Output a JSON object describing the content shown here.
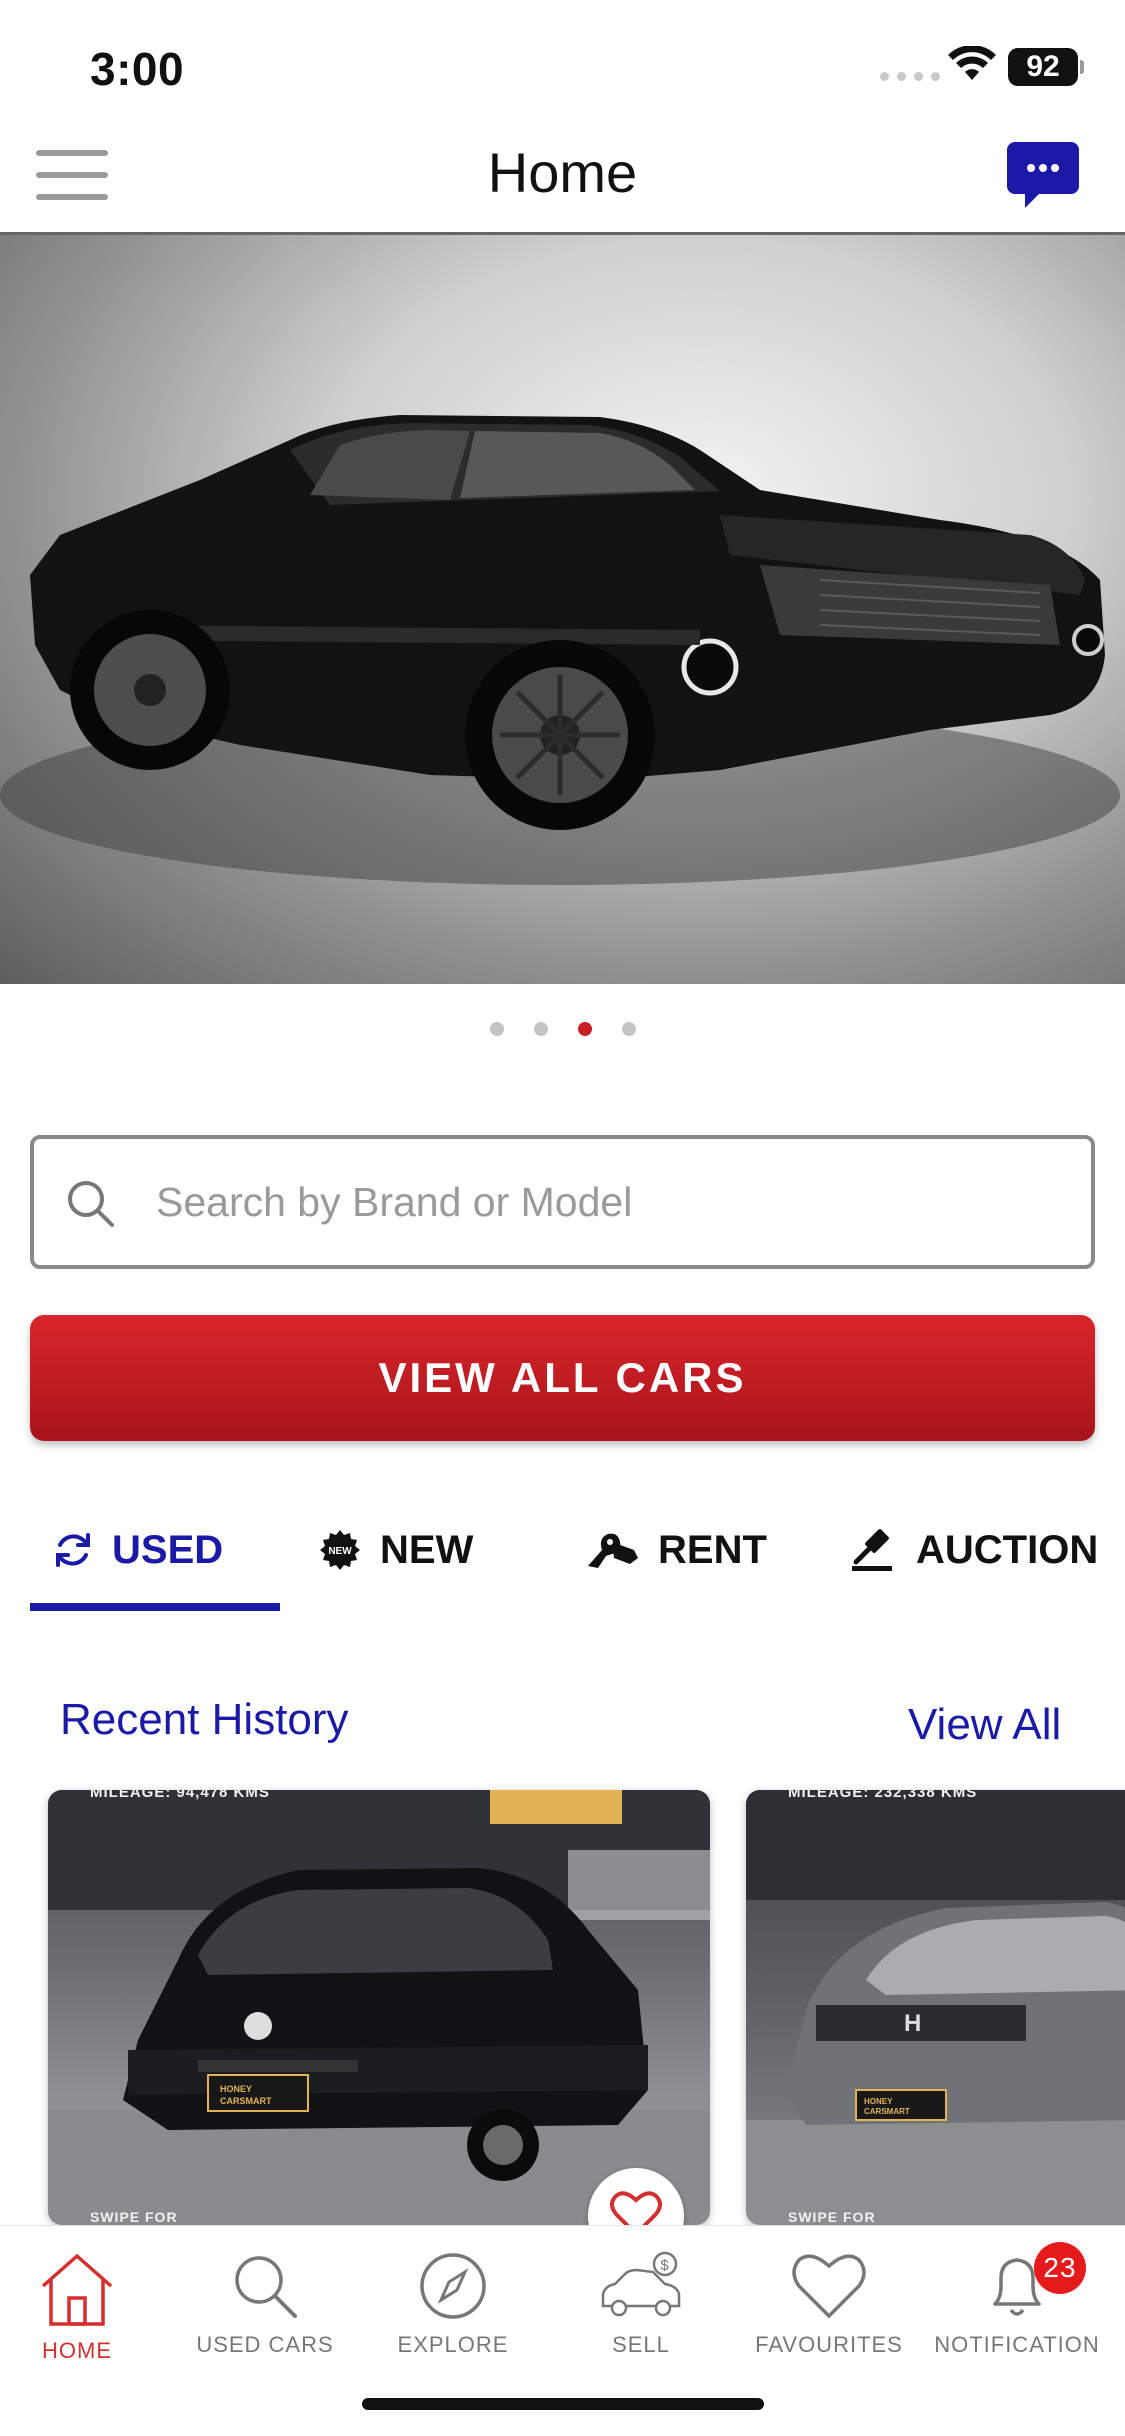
{
  "status_bar": {
    "time": "3:00",
    "battery": "92"
  },
  "header": {
    "title": "Home"
  },
  "carousel": {
    "slide_count": 4,
    "active_index": 2
  },
  "search": {
    "placeholder": "Search by Brand or Model"
  },
  "primary_button": {
    "label": "VIEW ALL CARS"
  },
  "tabs": [
    {
      "label": "USED",
      "icon": "refresh-icon",
      "active": true
    },
    {
      "label": "NEW",
      "icon": "new-badge-icon",
      "active": false
    },
    {
      "label": "RENT",
      "icon": "car-key-icon",
      "active": false
    },
    {
      "label": "AUCTION",
      "icon": "gavel-icon",
      "active": false
    }
  ],
  "recent_history": {
    "title": "Recent History",
    "view_all": "View All",
    "cards": [
      {
        "mileage": "MILEAGE: 94,478 KMS",
        "swipe": "SWIPE FOR",
        "plate": "HONEY CARSMART"
      },
      {
        "mileage": "MILEAGE: 232,338 KMS",
        "swipe": "SWIPE FOR",
        "plate": "HONEY CARSMART"
      }
    ]
  },
  "bottom_nav": [
    {
      "label": "HOME",
      "icon": "home-icon",
      "active": true
    },
    {
      "label": "USED CARS",
      "icon": "search-icon",
      "active": false
    },
    {
      "label": "EXPLORE",
      "icon": "compass-icon",
      "active": false
    },
    {
      "label": "SELL",
      "icon": "sell-car-icon",
      "active": false
    },
    {
      "label": "FAVOURITES",
      "icon": "heart-icon",
      "active": false
    },
    {
      "label": "NOTIFICATION",
      "icon": "bell-icon",
      "active": false,
      "badge": "23"
    }
  ],
  "colors": {
    "brand_red": "#c62026",
    "brand_blue": "#1a1aa6",
    "ribbon": "#e2b356"
  }
}
